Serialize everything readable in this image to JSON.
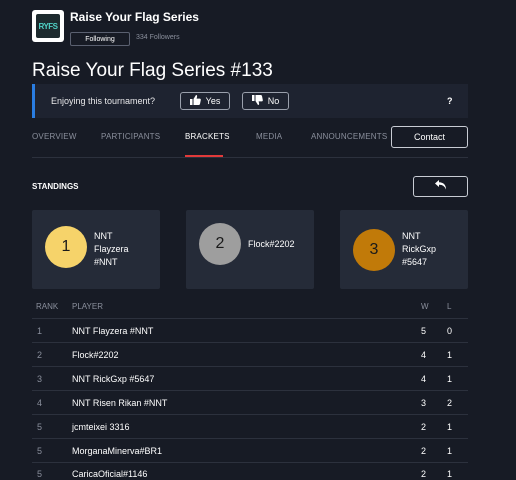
{
  "header": {
    "logo_text": "RYFS",
    "series_name": "Raise Your Flag Series",
    "following_label": "Following",
    "followers": "334 Followers"
  },
  "page_title": "Raise Your Flag Series #133",
  "poll": {
    "question": "Enjoying this tournament?",
    "yes_label": "Yes",
    "no_label": "No",
    "help": "?"
  },
  "tabs": [
    {
      "label": "OVERVIEW"
    },
    {
      "label": "PARTICIPANTS"
    },
    {
      "label": "BRACKETS"
    },
    {
      "label": "MEDIA"
    },
    {
      "label": "ANNOUNCEMENTS"
    }
  ],
  "active_tab": "BRACKETS",
  "contact_label": "Contact",
  "standings": {
    "title": "STANDINGS",
    "back_icon": "undo-arrow-icon",
    "podium": [
      {
        "place": "1",
        "lines": [
          "NNT",
          "Flayzera",
          "#NNT"
        ]
      },
      {
        "place": "2",
        "lines": [
          "Flock#2202"
        ]
      },
      {
        "place": "3",
        "lines": [
          "NNT",
          "RickGxp",
          "#5647"
        ]
      }
    ]
  },
  "table": {
    "headers": {
      "rank": "RANK",
      "player": "PLAYER",
      "w": "W",
      "l": "L"
    },
    "rows": [
      {
        "rank": "1",
        "player": "NNT Flayzera #NNT",
        "w": "5",
        "l": "0"
      },
      {
        "rank": "2",
        "player": "Flock#2202",
        "w": "4",
        "l": "1"
      },
      {
        "rank": "3",
        "player": "NNT RickGxp #5647",
        "w": "4",
        "l": "1"
      },
      {
        "rank": "4",
        "player": "NNT Risen Rikan #NNT",
        "w": "3",
        "l": "2"
      },
      {
        "rank": "5",
        "player": "jcmteixei 3316",
        "w": "2",
        "l": "1"
      },
      {
        "rank": "5",
        "player": "MorganaMinerva#BR1",
        "w": "2",
        "l": "1"
      },
      {
        "rank": "5",
        "player": "CaricaOficial#1146",
        "w": "2",
        "l": "1"
      }
    ]
  },
  "colors": {
    "background": "#171b25",
    "gold": "#f6d36a",
    "silver": "#9e9e9e",
    "bronze": "#c17a09",
    "active_tab_underline": "#e23a3a",
    "poll_accent": "#2a7de1"
  }
}
